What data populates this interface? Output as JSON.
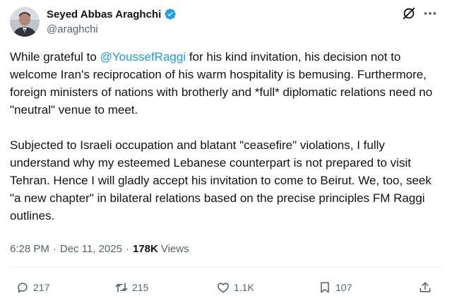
{
  "author": {
    "display_name": "Seyed Abbas Araghchi",
    "handle": "@araghchi",
    "verified": true
  },
  "tweet": {
    "paragraph1": {
      "before_mention": "While grateful to ",
      "mention": "@YoussefRaggi",
      "after_mention": " for his kind invitation, his decision not to welcome Iran's reciprocation of his warm hospitality is bemusing. Furthermore, foreign ministers of nations with brotherly and *full* diplomatic relations need no \"neutral\" venue to meet."
    },
    "paragraph2": "Subjected to Israeli occupation and blatant \"ceasefire\" violations, I fully understand why my esteemed Lebanese counterpart is not prepared to visit Tehran. Hence I will gladly accept his invitation to come to Beirut. We, too, seek \"a new chapter\" in bilateral relations based on the precise principles FM Raggi outlines."
  },
  "meta": {
    "time": "6:28 PM",
    "separator1": "·",
    "date": "Dec 11, 2025",
    "separator2": "·",
    "views_count": "178K",
    "views_label": "Views"
  },
  "actions": {
    "replies": "217",
    "reposts": "215",
    "likes": "1.1K",
    "bookmarks": "107"
  },
  "colors": {
    "accent": "#1d9bf0",
    "text": "#0f1419",
    "secondary": "#536471"
  },
  "icons": {
    "verified": "verified-badge-icon",
    "grok": "grok-icon",
    "more": "more-horizontal-icon",
    "reply": "reply-icon",
    "repost": "repost-icon",
    "like": "heart-icon",
    "bookmark": "bookmark-icon",
    "share": "share-icon"
  }
}
